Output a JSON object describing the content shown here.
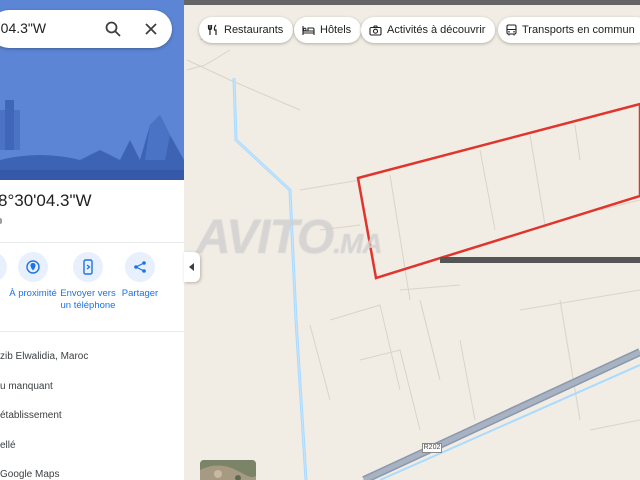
{
  "search": {
    "text": "'04.3\"W"
  },
  "place": {
    "title": "8°30'04.3\"W"
  },
  "actions": [
    {
      "label": "r",
      "icon": "directions-icon"
    },
    {
      "label": "À proximité",
      "icon": "nearby-icon"
    },
    {
      "label": "Envoyer vers un téléphone",
      "icon": "send-to-phone-icon"
    },
    {
      "label": "Partager",
      "icon": "share-icon"
    }
  ],
  "info_rows": [
    "zib Elwalidia, Maroc",
    "u manquant",
    "établissement",
    "ellé",
    "Google Maps"
  ],
  "chips": [
    {
      "label": "Restaurants",
      "icon": "fork-knife-icon"
    },
    {
      "label": "Hôtels",
      "icon": "bed-icon"
    },
    {
      "label": "Activités à découvrir",
      "icon": "camera-icon"
    },
    {
      "label": "Transports en commun",
      "icon": "bus-icon"
    }
  ],
  "road_label": "R202",
  "watermark": {
    "main": "AVITO",
    "suffix": ".MA"
  },
  "colors": {
    "map_bg": "#f1ede4",
    "hero_bg": "#5c85d6",
    "accent_blue": "#1a73e8",
    "parcel_outline": "#e0342d",
    "water": "#aadaff"
  }
}
